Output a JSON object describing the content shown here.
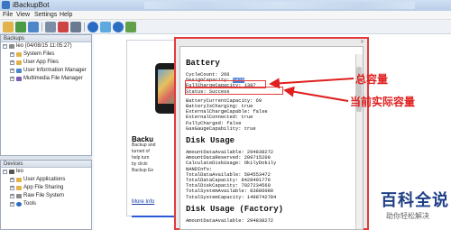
{
  "window": {
    "title": "iBackupBot"
  },
  "menu": [
    "File",
    "View",
    "Settings",
    "Help"
  ],
  "backups": {
    "header": "Backups",
    "root": "leo (04/08/15 11:05:27)",
    "items": [
      "System Files",
      "User App Files",
      "User Information Manager",
      "Multimedia File Manager"
    ]
  },
  "devices": {
    "header": "Devices",
    "root": "leo",
    "items": [
      "User Applications",
      "App File Sharing",
      "Raw File System",
      "Tools"
    ]
  },
  "left_card": {
    "title": "Backu",
    "text": [
      "Backup and",
      "turned of",
      "help turn",
      "by clicki",
      "Backup Ee"
    ],
    "link": "More Info"
  },
  "report": {
    "battery": {
      "heading": "Battery",
      "cycle": "CycleCount: 266",
      "design_label": "DesignCapacity: ",
      "design_value": "1420",
      "full": "FullChargeCapacity: 1387",
      "status": "Status: Success",
      "lines": [
        "BatteryCurrentCapacity: 69",
        "BatteryIsCharging: true",
        "ExternalChargeCapable: false",
        "ExternalConnected: true",
        "FullyCharged: false",
        "GasGaugeCapability: true"
      ]
    },
    "disk": {
      "heading": "Disk Usage",
      "lines": [
        "AmountDataAvailable: 294838272",
        "AmountDataReserved: 209715200",
        "CalculateDiskUsage: OkilyDokily",
        "NANDInfo:",
        "TotalDataAvailable: 504553472",
        "TotalDataCapacity: 8428491776",
        "TotalDiskCapacity: 7927234560",
        "TotalSystemAvailable: 83886080",
        "TotalSystemCapacity: 1498742784"
      ]
    },
    "disk_factory": {
      "heading": "Disk Usage (Factory)",
      "lines": [
        "AmountDataAvailable: 294838272"
      ]
    }
  },
  "annotations": {
    "total": "总容量",
    "current": "当前实际容量"
  },
  "watermark": {
    "big": "百科全说",
    "small": "助你轻松解决"
  }
}
